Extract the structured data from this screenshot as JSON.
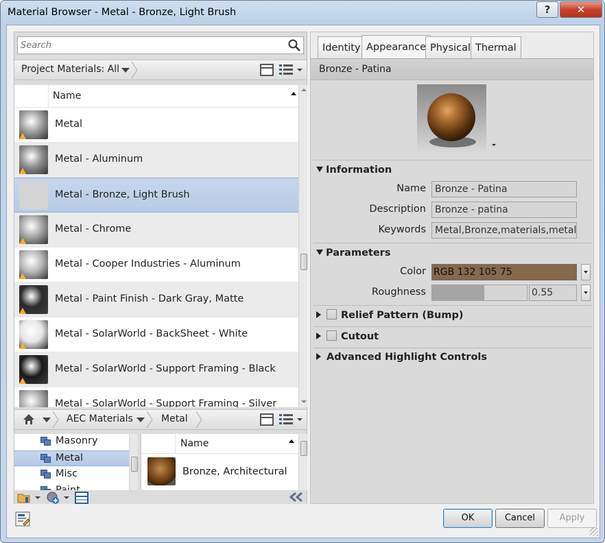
{
  "window": {
    "title": "Material Browser - Metal - Bronze, Light Brush",
    "help_glyph": "?",
    "close_glyph": "✕"
  },
  "search": {
    "placeholder": "Search"
  },
  "project_bar": {
    "label": "Project Materials: All"
  },
  "materials_table": {
    "header": "Name",
    "rows": [
      {
        "label": "Metal",
        "swatch": "#9d9d9d",
        "warning": true
      },
      {
        "label": "Metal - Aluminum",
        "swatch": "#8d8d8d",
        "warning": true
      },
      {
        "label": "Metal - Bronze, Light Brush",
        "swatch": "#d4d4d4",
        "warning": false,
        "selected": true
      },
      {
        "label": "Metal - Chrome",
        "swatch": "#a5a5a5",
        "warning": true
      },
      {
        "label": "Metal - Cooper Industries - Aluminum",
        "swatch": "#b7b7b7",
        "warning": true
      },
      {
        "label": "Metal - Paint Finish - Dark Gray, Matte",
        "swatch": "#2a2a2a",
        "warning": true
      },
      {
        "label": "Metal - SolarWorld - BackSheet - White",
        "swatch": "#e6e6e6",
        "warning": true
      },
      {
        "label": "Metal - SolarWorld - Support Framing - Black",
        "swatch": "#1a1a1a",
        "warning": true
      },
      {
        "label": "Metal - SolarWorld - Support Framing - Silver",
        "swatch": "#a7a7a7",
        "warning": false
      }
    ]
  },
  "library_bar": {
    "crumbs": [
      "AEC Materials",
      "Metal"
    ]
  },
  "library_tree": {
    "items": [
      {
        "label": "Masonry",
        "selected": false
      },
      {
        "label": "Metal",
        "selected": true
      },
      {
        "label": "Misc",
        "selected": false
      },
      {
        "label": "Paint",
        "selected": false
      }
    ]
  },
  "library_list": {
    "header": "Name",
    "items": [
      {
        "label": "Bronze, Architectural",
        "swatch": "#7a4a1a"
      }
    ]
  },
  "tabs": [
    {
      "label": "Identity",
      "active": false
    },
    {
      "label": "Appearance",
      "active": true
    },
    {
      "label": "Physical",
      "active": false
    },
    {
      "label": "Thermal",
      "active": false
    }
  ],
  "appearance": {
    "asset_name": "Bronze - Patina",
    "information": {
      "heading": "Information",
      "name_label": "Name",
      "name_value": "Bronze - Patina",
      "description_label": "Description",
      "description_value": "Bronze - patina",
      "keywords_label": "Keywords",
      "keywords_value": "Metal,Bronze,materials,metal"
    },
    "parameters": {
      "heading": "Parameters",
      "color_label": "Color",
      "color_value": "RGB 132 105 75",
      "color_hex": "#84694b",
      "roughness_label": "Roughness",
      "roughness_value": "0.55",
      "roughness_fraction": 0.55
    },
    "relief_heading": "Relief Pattern (Bump)",
    "cutout_heading": "Cutout",
    "advanced_heading": "Advanced Highlight Controls"
  },
  "buttons": {
    "ok": "OK",
    "cancel": "Cancel",
    "apply": "Apply"
  }
}
